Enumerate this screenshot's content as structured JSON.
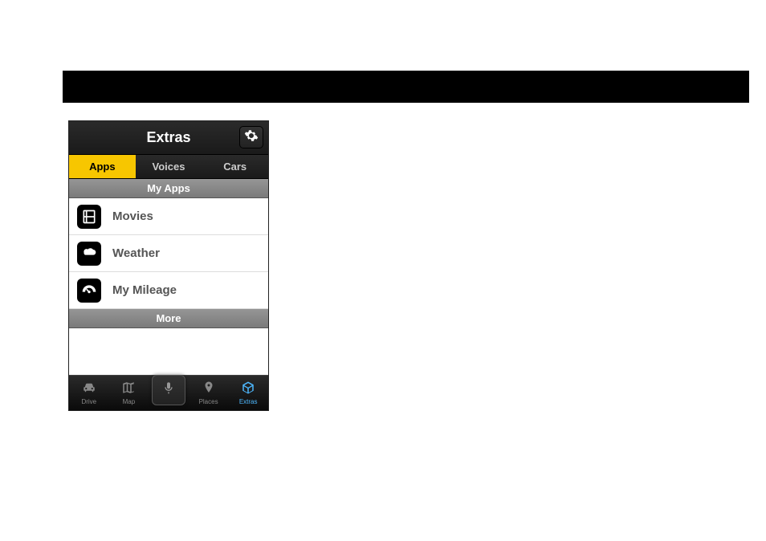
{
  "header": {
    "title": "Extras"
  },
  "tabs": [
    {
      "label": "Apps",
      "active": true
    },
    {
      "label": "Voices",
      "active": false
    },
    {
      "label": "Cars",
      "active": false
    }
  ],
  "section": {
    "title": "My Apps"
  },
  "apps": [
    {
      "label": "Movies",
      "icon": "film"
    },
    {
      "label": "Weather",
      "icon": "weather"
    },
    {
      "label": "My Mileage",
      "icon": "gauge"
    }
  ],
  "more": {
    "label": "More"
  },
  "nav": [
    {
      "label": "Drive",
      "icon": "car"
    },
    {
      "label": "Map",
      "icon": "map"
    },
    {
      "label": "",
      "icon": "mic"
    },
    {
      "label": "Places",
      "icon": "pin"
    },
    {
      "label": "Extras",
      "icon": "cube",
      "active": true
    }
  ]
}
